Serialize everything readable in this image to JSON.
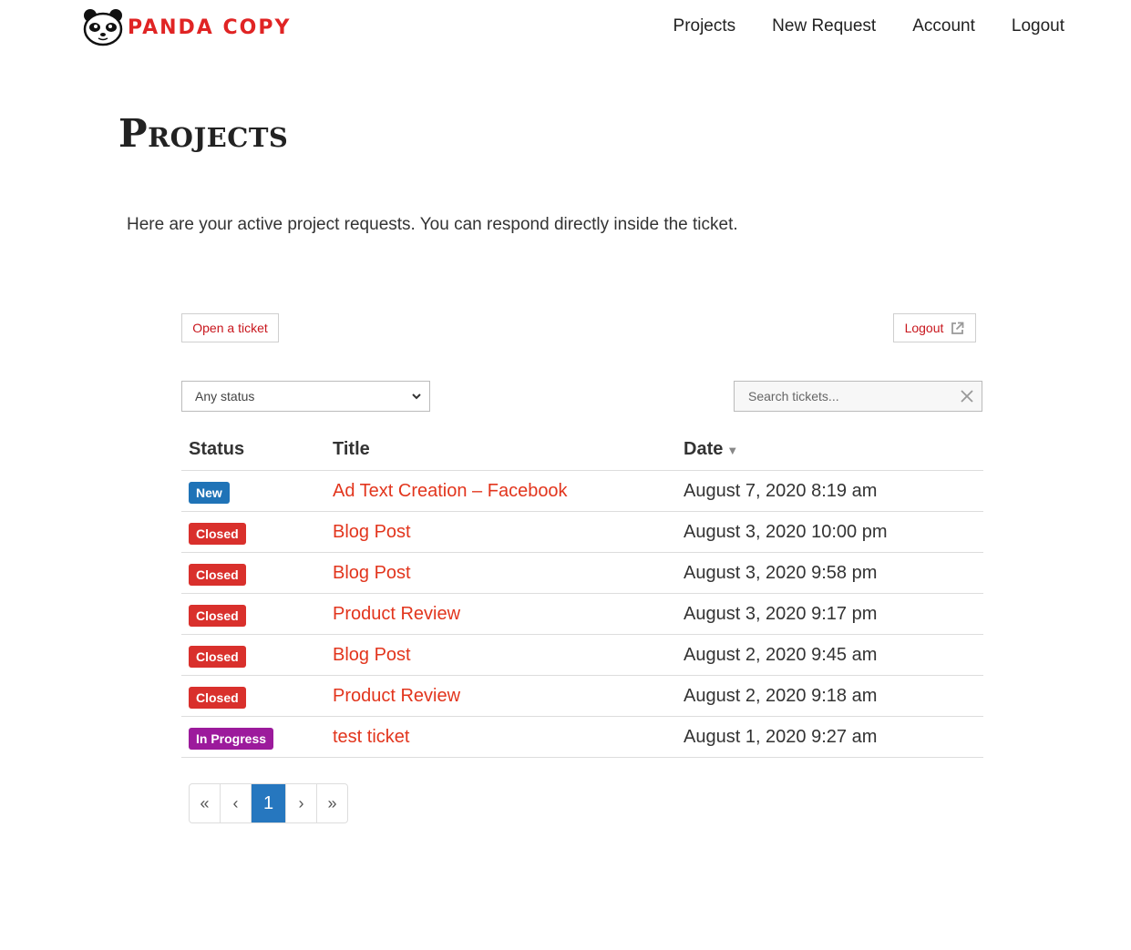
{
  "brand": {
    "name": "PANDA COPY",
    "accent": "#e02424"
  },
  "nav": [
    {
      "label": "Projects"
    },
    {
      "label": "New Request"
    },
    {
      "label": "Account"
    },
    {
      "label": "Logout"
    }
  ],
  "page": {
    "title": "Projects",
    "intro": "Here are your active project requests. You can respond directly inside the ticket."
  },
  "toolbar": {
    "open_ticket_label": "Open a ticket",
    "logout_label": "Logout",
    "logout_icon": "external-link-icon"
  },
  "filters": {
    "status_selected": "Any status",
    "search_placeholder": "Search tickets..."
  },
  "table": {
    "headers": {
      "status": "Status",
      "title": "Title",
      "date": "Date"
    },
    "sort_indicator": "▼",
    "rows": [
      {
        "status": "New",
        "status_color": "#1f73b7",
        "title": "Ad Text Creation – Facebook",
        "date": "August 7, 2020 8:19 am"
      },
      {
        "status": "Closed",
        "status_color": "#d9302c",
        "title": "Blog Post",
        "date": "August 3, 2020 10:00 pm"
      },
      {
        "status": "Closed",
        "status_color": "#d9302c",
        "title": "Blog Post",
        "date": "August 3, 2020 9:58 pm"
      },
      {
        "status": "Closed",
        "status_color": "#d9302c",
        "title": "Product Review",
        "date": "August 3, 2020 9:17 pm"
      },
      {
        "status": "Closed",
        "status_color": "#d9302c",
        "title": "Blog Post",
        "date": "August 2, 2020 9:45 am"
      },
      {
        "status": "Closed",
        "status_color": "#d9302c",
        "title": "Product Review",
        "date": "August 2, 2020 9:18 am"
      },
      {
        "status": "In Progress",
        "status_color": "#9c1a9c",
        "title": "test ticket",
        "date": "August 1, 2020 9:27 am"
      }
    ]
  },
  "pagination": {
    "first": "«",
    "prev": "‹",
    "current": "1",
    "next": "›",
    "last": "»",
    "current_color": "#2677bf"
  }
}
